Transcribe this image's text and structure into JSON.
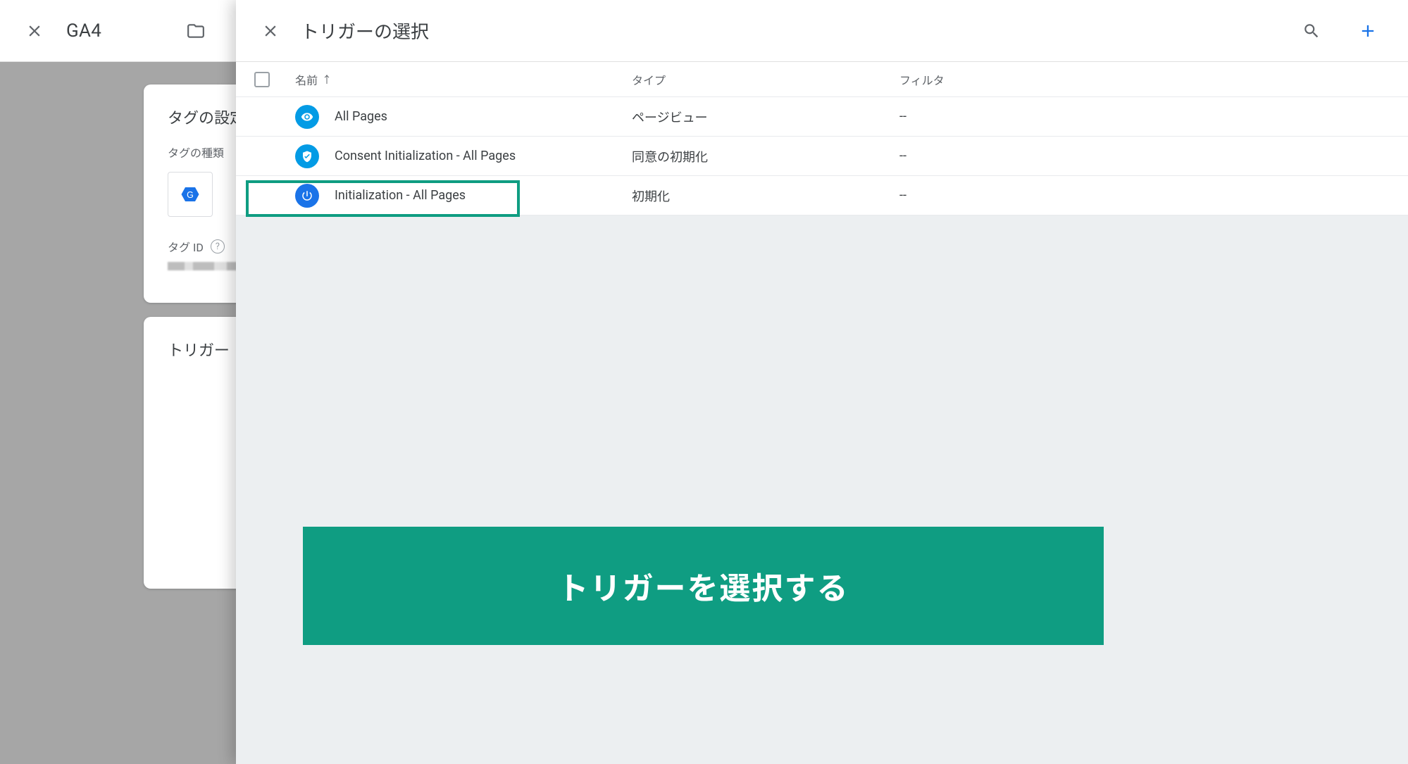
{
  "background": {
    "tag_name": "GA4",
    "card1": {
      "title": "タグの設定",
      "subtitle": "タグの種類",
      "tagid_label": "タグ ID"
    },
    "card2": {
      "title": "トリガー"
    }
  },
  "panel": {
    "title": "トリガーの選択",
    "columns": {
      "name": "名前",
      "type": "タイプ",
      "filter": "フィルタ"
    },
    "rows": [
      {
        "icon": "eye",
        "name": "All Pages",
        "type": "ページビュー",
        "filter": "--"
      },
      {
        "icon": "shield",
        "name": "Consent Initialization - All Pages",
        "type": "同意の初期化",
        "filter": "--"
      },
      {
        "icon": "power",
        "name": "Initialization - All Pages",
        "type": "初期化",
        "filter": "--"
      }
    ]
  },
  "annotation": {
    "banner_text": "トリガーを選択する"
  }
}
